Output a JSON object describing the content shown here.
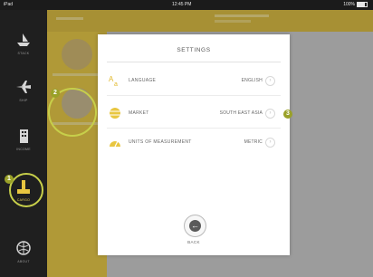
{
  "status_bar": {
    "carrier": "iPad",
    "time": "12:45 PM",
    "battery": "100%"
  },
  "nav": {
    "items": [
      {
        "label": "STACK",
        "icon": "ship-icon"
      },
      {
        "label": "SHIP",
        "icon": "plane-icon"
      },
      {
        "label": "INCOME",
        "icon": "building-icon"
      },
      {
        "label": "CARGO",
        "icon": "crane-icon"
      },
      {
        "label": "ABOUT",
        "icon": "globe-icon"
      }
    ]
  },
  "modal": {
    "title": "SETTINGS",
    "rows": [
      {
        "label": "LANGUAGE",
        "value": "ENGLISH"
      },
      {
        "label": "MARKET",
        "value": "SOUTH EAST ASIA"
      },
      {
        "label": "UNITS OF MEASUREMENT",
        "value": "METRIC"
      }
    ],
    "back_label": "BACK"
  },
  "callouts": {
    "one": "1",
    "two": "2",
    "three": "3"
  },
  "colors": {
    "accent_yellow": "#efd24a",
    "callout_green": "#9aa128",
    "nav_bg": "#1f1f1f"
  }
}
